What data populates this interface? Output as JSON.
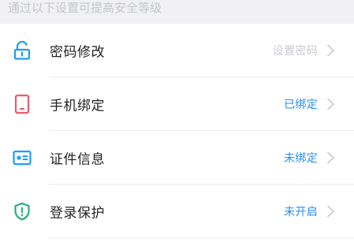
{
  "header": {
    "text": "通过以下设置可提高安全等级"
  },
  "items": [
    {
      "label": "密码修改",
      "status": "设置密码",
      "icon": "unlock-icon",
      "icon_color": "#1a9ff0",
      "status_color": "#c8cbd0"
    },
    {
      "label": "手机绑定",
      "status": "已绑定",
      "icon": "phone-icon",
      "icon_color": "#ee5a6d",
      "status_color": "#2b8ef2"
    },
    {
      "label": "证件信息",
      "status": "未绑定",
      "icon": "id-card-icon",
      "icon_color": "#1a9ff0",
      "status_color": "#2b8ef2"
    },
    {
      "label": "登录保护",
      "status": "未开启",
      "icon": "shield-icon",
      "icon_color": "#27b07b",
      "status_color": "#2b8ef2"
    }
  ],
  "colors": {
    "header_bg": "#f1f1f3",
    "header_text": "#c3c6cc",
    "label_text": "#222326",
    "chevron": "#c8cbd0",
    "divider": "#ececee"
  }
}
